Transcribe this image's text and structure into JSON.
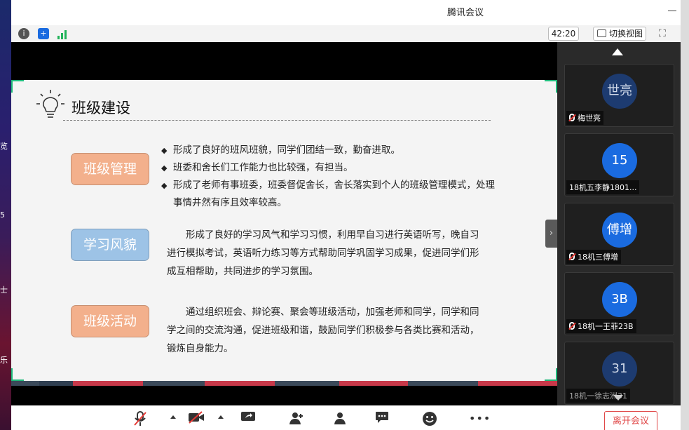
{
  "app": {
    "title": "腾讯会议"
  },
  "toolbar": {
    "timer": "42:20",
    "switch_view": "切换视图"
  },
  "slide": {
    "title": "班级建设",
    "sections": [
      {
        "tag": "班级管理",
        "color": "#f3b08c",
        "bullets": [
          "形成了良好的班风班貌，同学们团结一致，勤奋进取。",
          "班委和舍长们工作能力也比较强，有担当。",
          "形成了老师有事班委，班委督促舍长，舍长落实到个人的班级管理模式，处理事情井然有序且效率较高。"
        ]
      },
      {
        "tag": "学习风貌",
        "color": "#9dc3e6",
        "text": "形成了良好的学习风气和学习习惯，利用早自习进行英语听写，晚自习进行模拟考试，英语听力练习等方式帮助同学巩固学习成果，促进同学们形成互相帮助，共同进步的学习氛围。"
      },
      {
        "tag": "班级活动",
        "color": "#f3b08c",
        "text": "通过组织班会、辩论赛、聚会等班级活动，加强老师和同学，同学和同学之间的交流沟通，促进班级和谐，鼓励同学们积极参与各类比赛和活动，锻炼自身能力。"
      }
    ]
  },
  "participants": [
    {
      "avatar": "世亮",
      "name": "梅世亮",
      "muted": true
    },
    {
      "avatar": "15",
      "name": "18机五李静1801...",
      "muted": false
    },
    {
      "avatar": "傅增",
      "name": "18机三傅增",
      "muted": true
    },
    {
      "avatar": "3B",
      "name": "18机一王菲23B",
      "muted": true
    },
    {
      "avatar": "31",
      "name": "18机一徐志洲31",
      "muted": false
    }
  ],
  "bottombar": {
    "leave": "离开会议"
  },
  "colors": {
    "accent_green": "#1fb97a",
    "avatar_blue": "#1a6be0",
    "leave_red": "#e04848"
  }
}
